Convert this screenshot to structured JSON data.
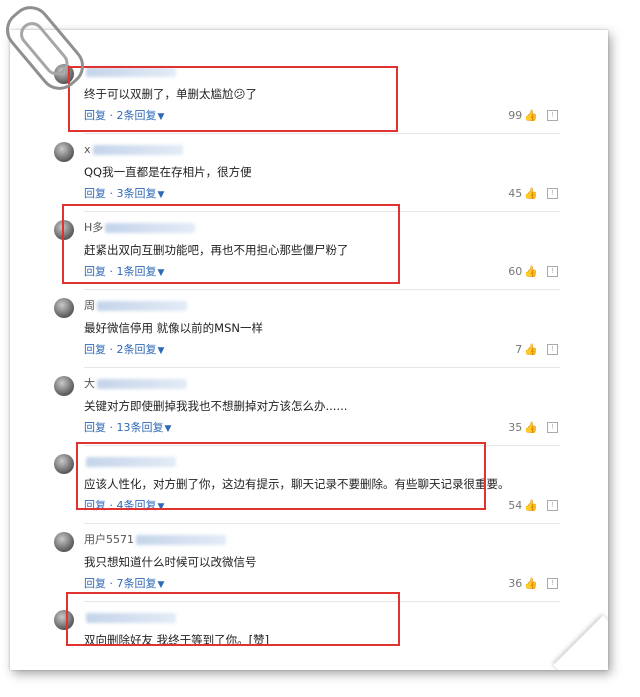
{
  "comments": [
    {
      "name": "",
      "text": "终于可以双删了，单删太尴尬😕了",
      "replies": "回复 · 2条回复",
      "likes": "99"
    },
    {
      "name": "x",
      "text": "QQ我一直都是在存相片，很方便",
      "replies": "回复 · 3条回复",
      "likes": "45"
    },
    {
      "name": "H多",
      "text": "赶紧出双向互删功能吧，再也不用担心那些僵尸粉了",
      "replies": "回复 · 1条回复",
      "likes": "60"
    },
    {
      "name": "周",
      "text": "最好微信停用 就像以前的MSN一样",
      "replies": "回复 · 2条回复",
      "likes": "7"
    },
    {
      "name": "大",
      "text": "关键对方即使删掉我我也不想删掉对方该怎么办......",
      "replies": "回复 · 13条回复",
      "likes": "35"
    },
    {
      "name": "",
      "text": "应该人性化，对方删了你，这边有提示，聊天记录不要删除。有些聊天记录很重要。",
      "replies": "回复 · 4条回复",
      "likes": "54"
    },
    {
      "name": "用户5571",
      "text": "我只想知道什么时候可以改微信号",
      "replies": "回复 · 7条回复",
      "likes": "36"
    },
    {
      "name": "",
      "text": "双向删除好友 我终于等到了你。[赞]",
      "replies": "",
      "likes": ""
    }
  ],
  "icons": {
    "thumb": "thumbs-up-icon",
    "report": "report-icon",
    "chevron": "chevron-down-icon"
  },
  "colors": {
    "highlight": "#e0322f",
    "link": "#2f68b6"
  }
}
